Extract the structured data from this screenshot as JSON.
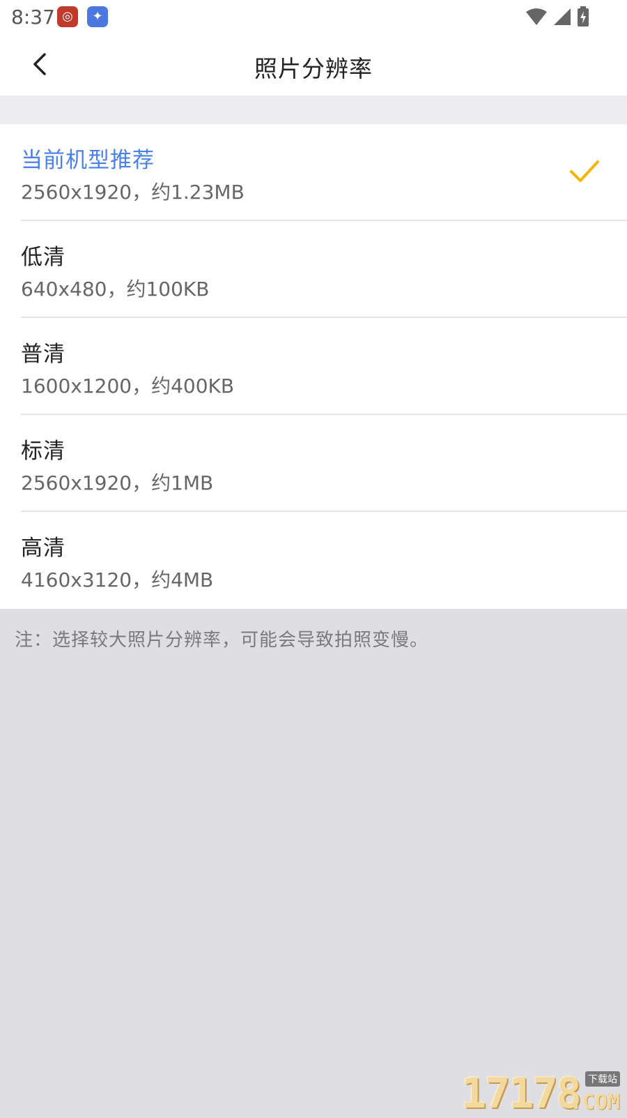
{
  "status_bar": {
    "time": "8:37",
    "icons": [
      "weibo-app-icon",
      "bird-app-icon",
      "wifi-icon",
      "signal-icon",
      "battery-charging-icon"
    ]
  },
  "header": {
    "title": "照片分辨率",
    "back_icon": "back-arrow-icon"
  },
  "options": [
    {
      "name": "当前机型推荐",
      "desc": "2560x1920，约1.23MB",
      "selected": true
    },
    {
      "name": "低清",
      "desc": "640x480，约100KB",
      "selected": false
    },
    {
      "name": "普清",
      "desc": "1600x1200，约400KB",
      "selected": false
    },
    {
      "name": "标清",
      "desc": "2560x1920，约1MB",
      "selected": false
    },
    {
      "name": "高清",
      "desc": "4160x3120，约4MB",
      "selected": false
    }
  ],
  "note": "注：选择较大照片分辨率，可能会导致拍照变慢。",
  "watermark": {
    "number": "17178",
    "site_label": "下载站",
    "suffix": ".COM"
  },
  "colors": {
    "accent_blue": "#4a80e8",
    "check_yellow": "#f5b400",
    "background": "#dfdee3"
  }
}
